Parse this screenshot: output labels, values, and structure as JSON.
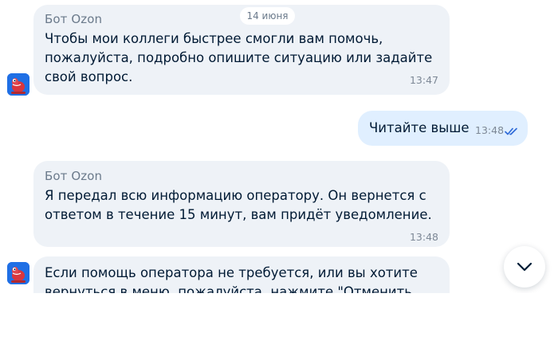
{
  "date_separator": "14 июня",
  "messages": [
    {
      "sender": "Бот Ozon",
      "lines": [
        "Чтобы мои коллеги быстрее смогли вам помочь,",
        "пожалуйста, подробно опишите ситуацию или задайте",
        "свой вопрос."
      ],
      "time": "13:47"
    },
    {
      "text": "Читайте выше",
      "time": "13:48",
      "status_icon": "double-check-icon"
    },
    {
      "sender": "Бот Ozon",
      "lines": [
        "Я передал всю информацию оператору. Он вернется с",
        "ответом в течение 15 минут, вам придёт уведомление."
      ],
      "time": "13:48"
    },
    {
      "lines": [
        "Если помощь оператора не требуется, или вы хотите",
        "вернуться в меню, пожалуйста, нажмите \"Отменить"
      ]
    }
  ],
  "scroll_button_icon": "chevron-down-icon",
  "colors": {
    "incoming_bubble": "#eef2f7",
    "outgoing_bubble": "#e0efff",
    "read_check": "#2f6bd8",
    "avatar_bg": "#1f6fe5",
    "text": "#001a34",
    "meta": "#7d8896"
  }
}
